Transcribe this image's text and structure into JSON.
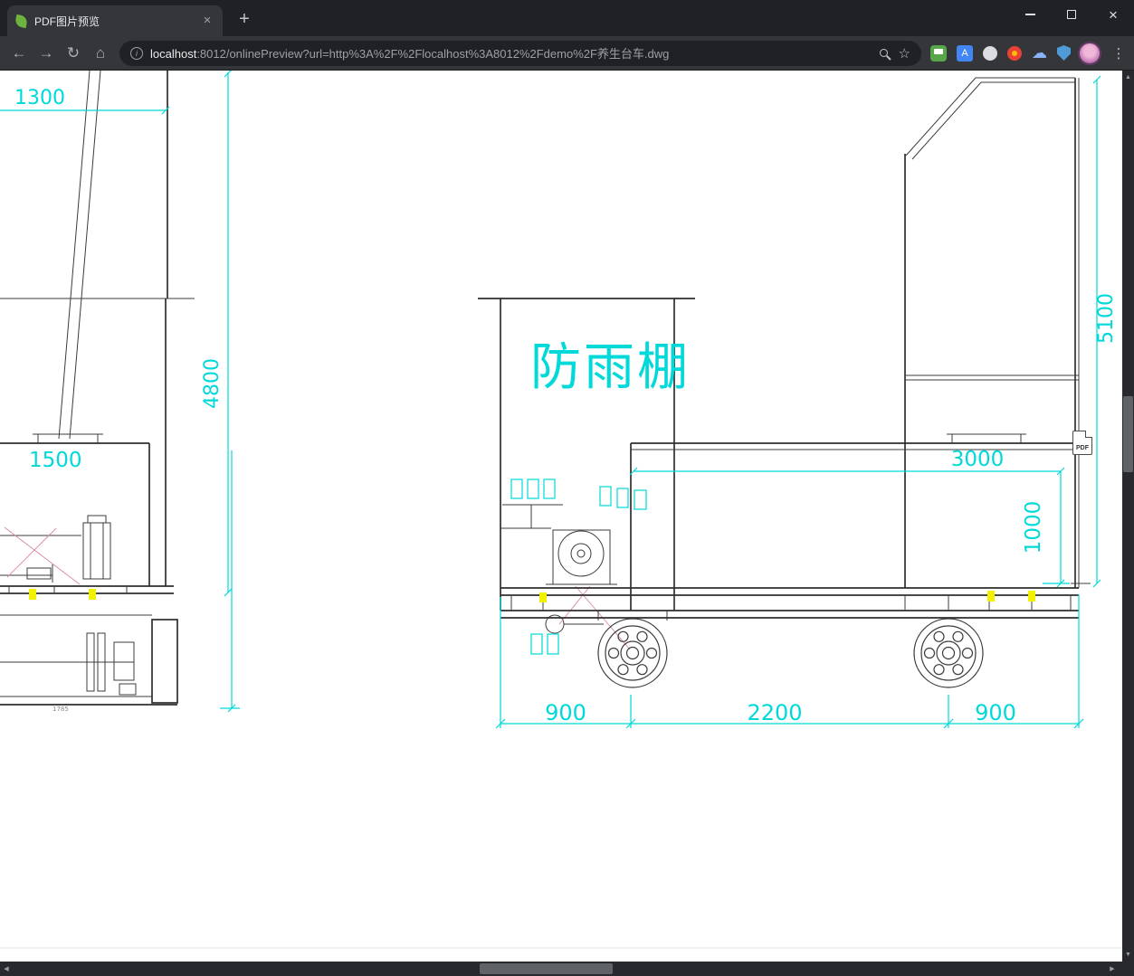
{
  "colors": {
    "dimension_cyan": "#00d9d9",
    "highlight_yellow": "#f2f200",
    "geometry_gray": "#3c3c3c",
    "accent_red": "#d988a0"
  },
  "window": {
    "tab_title": "PDF图片预览",
    "tab_close_glyph": "×",
    "new_tab_glyph": "+",
    "controls": {
      "close_glyph": "×"
    }
  },
  "toolbar": {
    "back_glyph": "←",
    "forward_glyph": "→",
    "reload_glyph": "↻",
    "home_glyph": "⌂",
    "menu_glyph": "⋮",
    "address": {
      "info_glyph": "i",
      "url_host": "localhost",
      "url_rest": ":8012/onlinePreview?url=http%3A%2F%2Flocalhost%3A8012%2Fdemo%2F养生台车.dwg",
      "bookmark_glyph": "☆"
    },
    "extensions": {
      "translate_glyph": "A",
      "cloud_glyph": "☁"
    }
  },
  "scrollbars": {
    "up_glyph": "▲",
    "down_glyph": "▼",
    "left_glyph": "◀",
    "right_glyph": "▶"
  },
  "drawing": {
    "shelter_label": "防雨棚",
    "pdf_badge_label": "PDF",
    "dims": {
      "d1300": "1300",
      "d4800": "4800",
      "d1500": "1500",
      "d5100": "5100",
      "d3000": "3000",
      "d1000": "1000",
      "d900_left": "900",
      "d2200": "2200",
      "d900_right": "900",
      "d1785": "1785"
    }
  }
}
